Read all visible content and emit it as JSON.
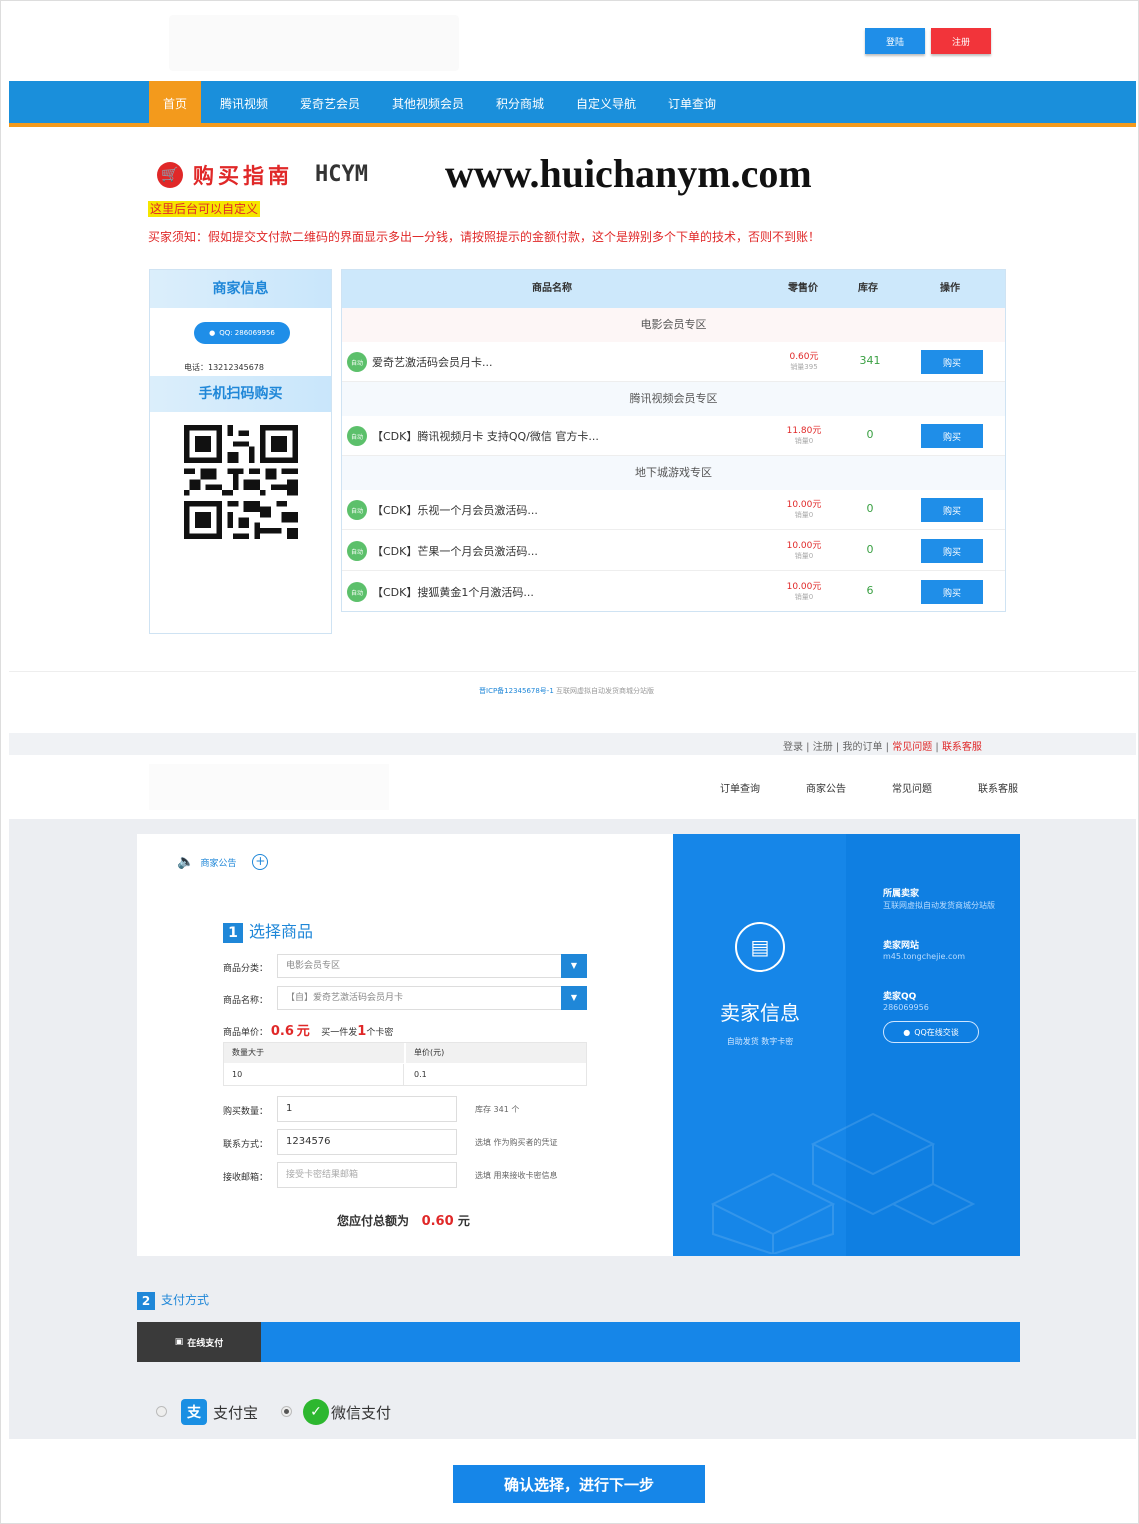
{
  "header": {
    "login_label": "登陆",
    "register_label": "注册"
  },
  "nav": [
    "首页",
    "腾讯视频",
    "爱奇艺会员",
    "其他视频会员",
    "积分商城",
    "自定义导航",
    "订单查询"
  ],
  "banner": {
    "guide_title": "购买指南",
    "guide_logo": "HCYM",
    "site_url": "www.huichanym.com",
    "custom_note": "这里后台可以自定义",
    "buyer_note": "买家须知：假如提交文付款二维码的界面显示多出一分钱，请按照提示的金额付款，这个是辨别多个下单的技术，否则不到账！"
  },
  "merchant": {
    "title": "商家信息",
    "qq": "QQ: 286069956",
    "phone": "电话：13212345678",
    "scan_title": "手机扫码购买"
  },
  "goods": {
    "headers": {
      "name": "商品名称",
      "price": "零售价",
      "stock": "库存",
      "action": "操作"
    },
    "zones": [
      "电影会员专区",
      "腾讯视频会员专区",
      "地下城游戏专区"
    ],
    "badge": "自动",
    "buy_label": "购买",
    "rows": [
      {
        "name": "爱奇艺激活码会员月卡...",
        "price": "0.60元",
        "sold": "销量395",
        "stock": "341"
      },
      {
        "name": "【CDK】腾讯视频月卡 支持QQ/微信 官方卡...",
        "price": "11.80元",
        "sold": "销量0",
        "stock": "0"
      },
      {
        "name": "【CDK】乐视一个月会员激活码...",
        "price": "10.00元",
        "sold": "销量0",
        "stock": "0"
      },
      {
        "name": "【CDK】芒果一个月会员激活码...",
        "price": "10.00元",
        "sold": "销量0",
        "stock": "0"
      },
      {
        "name": "【CDK】搜狐黄金1个月激活码...",
        "price": "10.00元",
        "sold": "销量0",
        "stock": "6"
      }
    ]
  },
  "footer1": {
    "icp": "晋ICP备12345678号-1",
    "rest": "互联网虚拟自动发货商城分站版"
  },
  "topbar2": {
    "login": "登录",
    "register": "注册",
    "my_orders": "我的订单",
    "faq": "常见问题",
    "contact": "联系客服"
  },
  "header2": {
    "links": [
      "订单查询",
      "商家公告",
      "常见问题",
      "联系客服"
    ]
  },
  "form": {
    "notice": "商家公告",
    "step1_no": "1",
    "step1_title": "选择商品",
    "category_label": "商品分类：",
    "category_value": "电影会员专区",
    "product_label": "商品名称：",
    "product_value": "【自】爱奇艺激活码会员月卡",
    "unit_label": "商品单价：",
    "unit_price": "0.6",
    "unit_currency": "元",
    "unit_note_a": "买一件发",
    "unit_note_num": "1",
    "unit_note_b": "个卡密",
    "tier_headers": [
      "数量大于",
      "单价(元)"
    ],
    "tier_values": [
      "10",
      "0.1"
    ],
    "qty_label": "购买数量：",
    "qty_value": "1",
    "qty_hint": "库存 341 个",
    "contact_label": "联系方式：",
    "contact_value": "1234576",
    "contact_hint": "选填 作为购买者的凭证",
    "email_label": "接收邮箱：",
    "email_placeholder": "接受卡密结果邮箱",
    "email_hint": "选填 用来接收卡密信息",
    "total_label": "您应付总额为",
    "total_amount": "0.60",
    "total_unit": "元"
  },
  "seller": {
    "title": "卖家信息",
    "subtitle": "自助发货  数字卡密",
    "shop_label": "所属卖家",
    "shop_value": "互联网虚拟自动发货商城分站版",
    "site_label": "卖家网站",
    "site_value": "m45.tongchejie.com",
    "qq_label": "卖家QQ",
    "qq_value": "286069956",
    "qq_btn": "QQ在线交谈"
  },
  "payment": {
    "step2_no": "2",
    "step2_title": "支付方式",
    "tab": "在线支付",
    "alipay": "支付宝",
    "wechat": "微信支付",
    "confirm": "确认选择，进行下一步"
  }
}
